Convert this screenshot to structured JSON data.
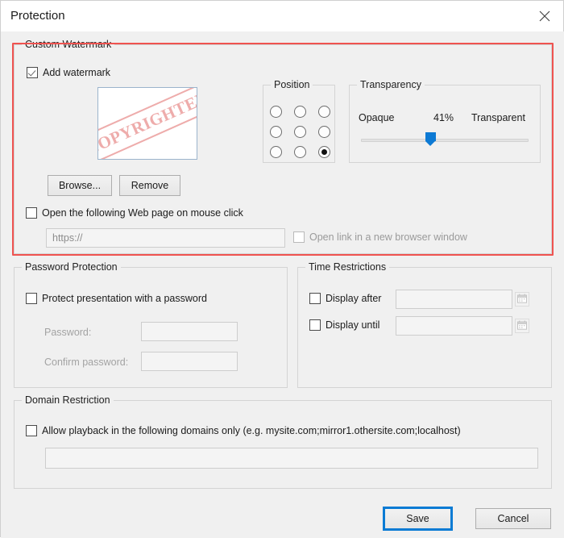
{
  "window": {
    "title": "Protection",
    "close_icon": "close-icon"
  },
  "watermark": {
    "group_label": "Custom Watermark",
    "add_watermark_label": "Add watermark",
    "add_watermark_checked": true,
    "preview_text": "COPYRIGHTED",
    "browse_label": "Browse...",
    "remove_label": "Remove",
    "open_web_page_label": "Open the following Web page on mouse click",
    "open_web_page_checked": false,
    "url_value": "https://",
    "new_window_label": "Open link in a new browser window",
    "new_window_checked": false,
    "highlight_color": "#ef5350"
  },
  "position": {
    "group_label": "Position",
    "options": [
      "top-left",
      "top-center",
      "top-right",
      "middle-left",
      "middle-center",
      "middle-right",
      "bottom-left",
      "bottom-center",
      "bottom-right"
    ],
    "selected_index": 8
  },
  "transparency": {
    "group_label": "Transparency",
    "opaque_label": "Opaque",
    "value_label": "41%",
    "transparent_label": "Transparent",
    "value": 41,
    "accent_color": "#0d7ad4"
  },
  "password": {
    "group_label": "Password Protection",
    "protect_label": "Protect presentation with a password",
    "protect_checked": false,
    "password_label": "Password:",
    "password_value": "",
    "confirm_label": "Confirm password:",
    "confirm_value": ""
  },
  "time": {
    "group_label": "Time Restrictions",
    "display_after_label": "Display after",
    "display_after_checked": false,
    "display_after_value": "",
    "display_until_label": "Display until",
    "display_until_checked": false,
    "display_until_value": "",
    "calendar_icon": "calendar-icon"
  },
  "domain": {
    "group_label": "Domain Restriction",
    "allow_label": "Allow playback in the following domains only (e.g. mysite.com;mirror1.othersite.com;localhost)",
    "allow_checked": false,
    "domains_value": ""
  },
  "footer": {
    "save_label": "Save",
    "cancel_label": "Cancel"
  }
}
